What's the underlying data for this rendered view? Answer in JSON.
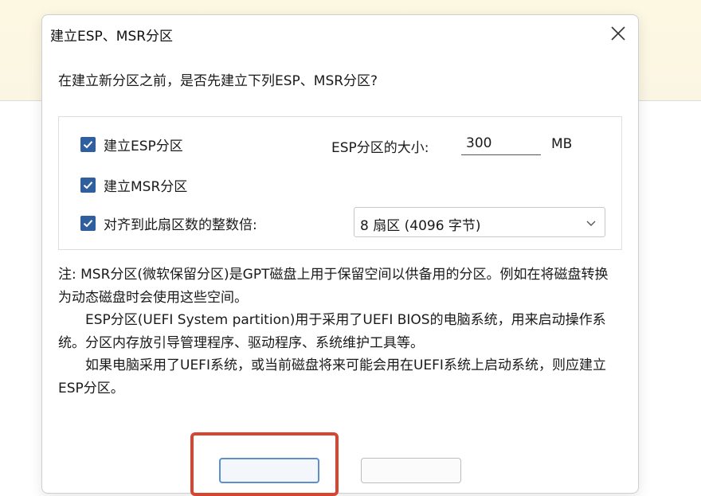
{
  "dialog": {
    "title": "建立ESP、MSR分区",
    "question": "在建立新分区之前，是否先建立下列ESP、MSR分区?"
  },
  "options": {
    "create_esp": {
      "label": "建立ESP分区",
      "checked": true
    },
    "create_msr": {
      "label": "建立MSR分区",
      "checked": true
    },
    "align": {
      "label": "对齐到此扇区数的整数倍:",
      "checked": true
    },
    "esp_size_label": "ESP分区的大小:",
    "esp_size_value": "300",
    "esp_size_unit": "MB",
    "align_selected": "8 扇区 (4096 字节)"
  },
  "notes": {
    "p1": "注: MSR分区(微软保留分区)是GPT磁盘上用于保留空间以供备用的分区。例如在将磁盘转换为动态磁盘时会使用这些空间。",
    "p2": "ESP分区(UEFI System partition)用于采用了UEFI BIOS的电脑系统，用来启动操作系统。分区内存放引导管理程序、驱动程序、系统维护工具等。",
    "p3": "如果电脑采用了UEFI系统，或当前磁盘将来可能会用在UEFI系统上启动系统，则应建立ESP分区。"
  },
  "colors": {
    "checkbox": "#2f5f9e",
    "highlight": "#d64530",
    "primary_button_border": "#5b8fd0"
  }
}
